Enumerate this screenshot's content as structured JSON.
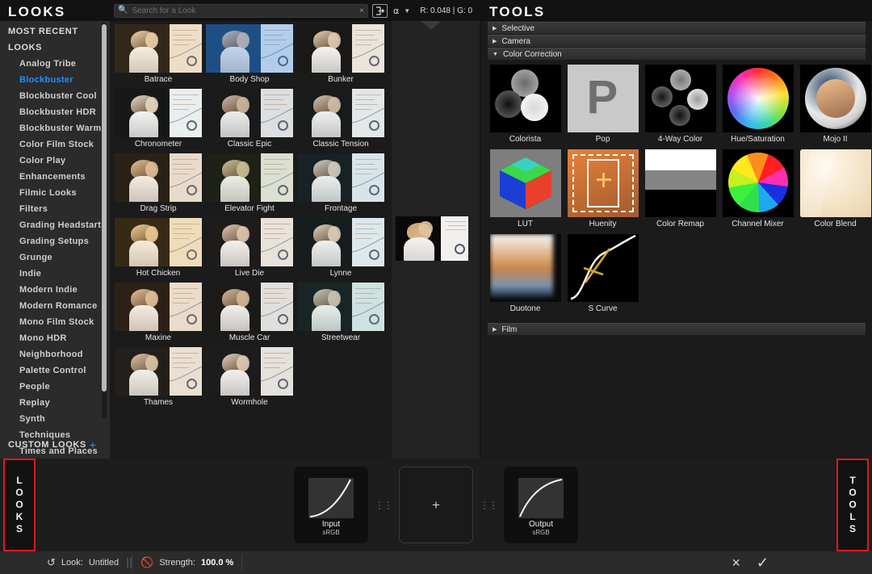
{
  "looks_panel": {
    "title": "LOOKS",
    "groups": [
      {
        "label": "MOST RECENT"
      },
      {
        "label": "LOOKS"
      }
    ],
    "categories": [
      {
        "label": "Analog Tribe",
        "selected": false
      },
      {
        "label": "Blockbuster",
        "selected": true
      },
      {
        "label": "Blockbuster Cool",
        "selected": false
      },
      {
        "label": "Blockbuster HDR",
        "selected": false
      },
      {
        "label": "Blockbuster Warm",
        "selected": false
      },
      {
        "label": "Color Film Stock",
        "selected": false
      },
      {
        "label": "Color Play",
        "selected": false
      },
      {
        "label": "Enhancements",
        "selected": false
      },
      {
        "label": "Filmic Looks",
        "selected": false
      },
      {
        "label": "Filters",
        "selected": false
      },
      {
        "label": "Grading Headstarts",
        "selected": false
      },
      {
        "label": "Grading Setups",
        "selected": false
      },
      {
        "label": "Grunge",
        "selected": false
      },
      {
        "label": "Indie",
        "selected": false
      },
      {
        "label": "Modern Indie",
        "selected": false
      },
      {
        "label": "Modern Romance",
        "selected": false
      },
      {
        "label": "Mono Film Stock",
        "selected": false
      },
      {
        "label": "Mono HDR",
        "selected": false
      },
      {
        "label": "Neighborhood",
        "selected": false
      },
      {
        "label": "Palette Control",
        "selected": false
      },
      {
        "label": "People",
        "selected": false
      },
      {
        "label": "Replay",
        "selected": false
      },
      {
        "label": "Synth",
        "selected": false
      },
      {
        "label": "Techniques",
        "selected": false
      },
      {
        "label": "Times and Places",
        "selected": false
      }
    ],
    "custom_looks": {
      "label": "CUSTOM LOOKS",
      "add": "+"
    }
  },
  "search": {
    "placeholder": "Search for a Look",
    "value": "",
    "icon": "search-icon",
    "clear_icon": "×",
    "import_icon": "import-icon"
  },
  "browser": {
    "looks": [
      {
        "name": "Batrace",
        "skin": "#f0d8b4",
        "bg": "#0b0806",
        "wall": "#efe5d8",
        "tint": "rgba(230,190,120,0.18)"
      },
      {
        "name": "Body Shop",
        "skin": "#e8cdb6",
        "bg": "#123a63",
        "wall": "#e6eef6",
        "tint": "rgba(60,130,210,0.30)"
      },
      {
        "name": "Bunker",
        "skin": "#e9d2b8",
        "bg": "#060606",
        "wall": "#efe9e0",
        "tint": "rgba(200,190,180,0.10)"
      },
      {
        "name": "Chronometer",
        "skin": "#f2ddc4",
        "bg": "#050505",
        "wall": "#f1f3f2",
        "tint": "rgba(180,200,200,0.10)"
      },
      {
        "name": "Classic Epic",
        "skin": "#d9bfa4",
        "bg": "#0a0a0a",
        "wall": "#e9e9e9",
        "tint": "rgba(140,150,160,0.12)"
      },
      {
        "name": "Classic Tension",
        "skin": "#dfc6ad",
        "bg": "#070707",
        "wall": "#eef0ef",
        "tint": "rgba(150,170,170,0.12)"
      },
      {
        "name": "Drag Strip",
        "skin": "#e6c79f",
        "bg": "#090806",
        "wall": "#ece5dc",
        "tint": "rgba(210,170,110,0.16)"
      },
      {
        "name": "Elevator Fight",
        "skin": "#d8c49f",
        "bg": "#0a0b08",
        "wall": "#e7e9e1",
        "tint": "rgba(150,170,120,0.14)"
      },
      {
        "name": "Frontage",
        "skin": "#e3d5c2",
        "bg": "#080a0b",
        "wall": "#e6eef0",
        "tint": "rgba(130,180,190,0.14)"
      },
      {
        "name": "Hot Chicken",
        "skin": "#f0d3a6",
        "bg": "#0b0805",
        "wall": "#f0e6d4",
        "tint": "rgba(230,180,90,0.20)"
      },
      {
        "name": "Live Die",
        "skin": "#e6cdb4",
        "bg": "#090909",
        "wall": "#eeeae4",
        "tint": "rgba(190,175,160,0.12)"
      },
      {
        "name": "Lynne",
        "skin": "#ead6c0",
        "bg": "#07090a",
        "wall": "#e8f0f1",
        "tint": "rgba(140,180,190,0.12)"
      },
      {
        "name": "Maxine",
        "skin": "#e8c7a6",
        "bg": "#0a0806",
        "wall": "#eee6dc",
        "tint": "rgba(215,165,110,0.16)"
      },
      {
        "name": "Muscle Car",
        "skin": "#ddbfa0",
        "bg": "#080808",
        "wall": "#e9e9e6",
        "tint": "rgba(170,160,150,0.12)"
      },
      {
        "name": "Streetwear",
        "skin": "#dccdbc",
        "bg": "#070a0a",
        "wall": "#dfeceb",
        "tint": "rgba(120,180,175,0.16)"
      },
      {
        "name": "Thames",
        "skin": "#e3cbb2",
        "bg": "#0a0908",
        "wall": "#f0e8df",
        "tint": "rgba(200,170,140,0.14)"
      },
      {
        "name": "Wormhole",
        "skin": "#e9d5bd",
        "bg": "#080808",
        "wall": "#ece9e4",
        "tint": "rgba(180,175,170,0.12)"
      }
    ]
  },
  "preview": {
    "readout": "R: 0.048 | G: 0",
    "eyedropper_icon": "eyedropper-icon",
    "caret_icon": "chevron-down-icon"
  },
  "tools_panel": {
    "title": "TOOLS",
    "sections": [
      {
        "label": "Selective",
        "expanded": false
      },
      {
        "label": "Camera",
        "expanded": false
      },
      {
        "label": "Color Correction",
        "expanded": true
      },
      {
        "label": "Film",
        "expanded": false
      }
    ],
    "tools": [
      {
        "name": "Colorista",
        "icon": "colorista-icon"
      },
      {
        "name": "Pop",
        "icon": "pop-icon"
      },
      {
        "name": "4-Way Color",
        "icon": "four-way-color-icon"
      },
      {
        "name": "Hue/Saturation",
        "icon": "hue-saturation-icon"
      },
      {
        "name": "Mojo II",
        "icon": "mojo-icon"
      },
      {
        "name": "LUT",
        "icon": "lut-cube-icon"
      },
      {
        "name": "Huenity",
        "icon": "huenity-icon"
      },
      {
        "name": "Color Remap",
        "icon": "color-remap-icon"
      },
      {
        "name": "Channel Mixer",
        "icon": "channel-mixer-icon"
      },
      {
        "name": "Color Blend",
        "icon": "color-blend-icon"
      },
      {
        "name": "Duotone",
        "icon": "duotone-icon"
      },
      {
        "name": "S Curve",
        "icon": "s-curve-icon"
      }
    ]
  },
  "node_graph": {
    "input": {
      "name": "Input",
      "colorspace": "sRGB"
    },
    "empty": {
      "plus": "+"
    },
    "output": {
      "name": "Output",
      "colorspace": "sRGB"
    }
  },
  "side_tabs": {
    "left": {
      "label": "LOOKS",
      "letters": [
        "L",
        "O",
        "O",
        "K",
        "S"
      ]
    },
    "right": {
      "label": "TOOLS",
      "letters": [
        "T",
        "O",
        "O",
        "L",
        "S"
      ]
    }
  },
  "status_bar": {
    "reset_icon": "undo-icon",
    "look_label": "Look:",
    "look_value": "Untitled",
    "disable_icon": "no-entry-icon",
    "strength_label": "Strength:",
    "strength_value": "100.0 %",
    "cancel_icon": "×",
    "confirm_icon": "✓"
  },
  "colors": {
    "accent_blue": "#1e90ff",
    "highlight_red": "#e01a1a",
    "panel_bg": "#1b1b1b",
    "sidebar_bg": "#2b2b2b",
    "header_bg": "#121212"
  }
}
